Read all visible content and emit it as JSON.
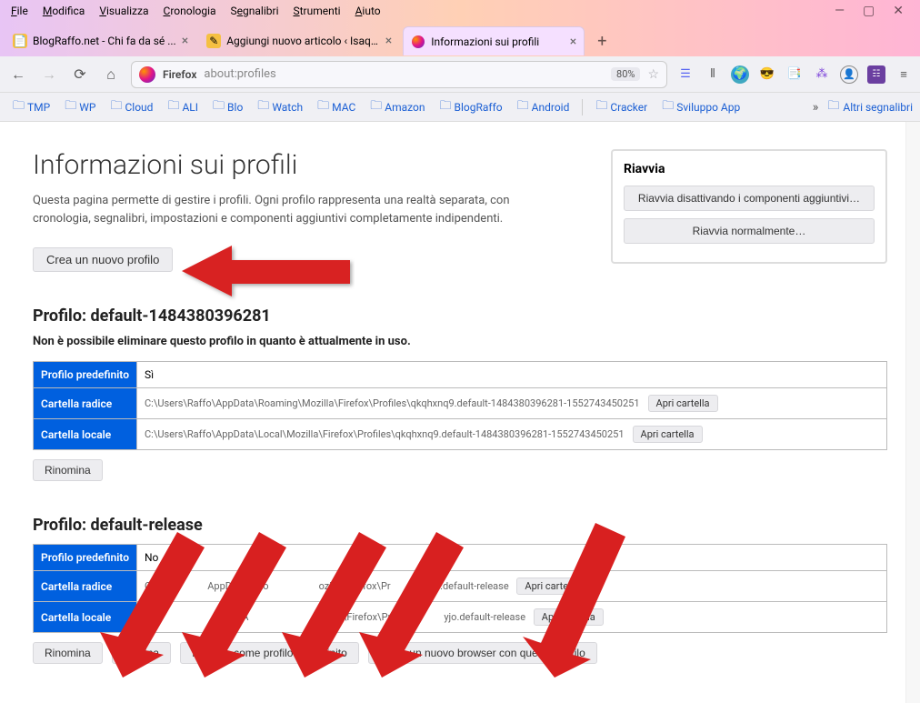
{
  "menubar": {
    "items": [
      "File",
      "Modifica",
      "Visualizza",
      "Cronologia",
      "Segnalibri",
      "Strumenti",
      "Aiuto"
    ]
  },
  "tabs": {
    "items": [
      {
        "title": "BlogRaffo.net - Chi fa da sé ..."
      },
      {
        "title": "Aggiungi nuovo articolo ‹ Isaqu..."
      },
      {
        "title": "Informazioni sui profili"
      }
    ]
  },
  "toolbar": {
    "identity": "Firefox",
    "url": "about:profiles",
    "zoom": "80%"
  },
  "bookmarks": {
    "items": [
      "TMP",
      "WP",
      "Cloud",
      "ALI",
      "Blo",
      "Watch",
      "MAC",
      "Amazon",
      "BlogRaffo",
      "Android",
      "Cracker",
      "Sviluppo App"
    ],
    "other": "Altri segnalibri",
    "more_icon": "»"
  },
  "page": {
    "title": "Informazioni sui profili",
    "description": "Questa pagina permette di gestire i profili. Ogni profilo rappresenta una realtà separata, con cronologia, segnalibri, impostazioni e componenti aggiuntivi completamente indipendenti.",
    "create_profile": "Crea un nuovo profilo",
    "restart": {
      "title": "Riavvia",
      "safe_mode": "Riavvia disattivando i componenti aggiuntivi…",
      "normal": "Riavvia normalmente…"
    },
    "labels": {
      "default_profile": "Profilo predefinito",
      "root_dir": "Cartella radice",
      "local_dir": "Cartella locale",
      "open_folder": "Apri cartella"
    },
    "buttons": {
      "rename": "Rinomina",
      "delete": "Elimina",
      "set_default": "Imposta come profilo predefinito",
      "launch": "Avvia un nuovo browser con questo profilo"
    },
    "profiles": [
      {
        "heading": "Profilo: default-1484380396281",
        "warning": "Non è possibile eliminare questo profilo in quanto è attualmente in uso.",
        "is_default": "Sì",
        "root": "C:\\Users\\Raffo\\AppData\\Roaming\\Mozilla\\Firefox\\Profiles\\qkqhxnq9.default-1484380396281-1552743450251",
        "local": "C:\\Users\\Raffo\\AppData\\Local\\Mozilla\\Firefox\\Profiles\\qkqhxnq9.default-1484380396281-1552743450251"
      },
      {
        "heading": "Profilo: default-release",
        "is_default": "No",
        "root_partial_a": "C",
        "root_partial_b": "AppD",
        "root_partial_c": "Ro",
        "root_partial_d": "ozilla\\Firefox\\Pr",
        "root_partial_e": "o.default-release",
        "local_partial_a": "o\\A",
        "local_partial_b": "\\Firefox\\Prof",
        "local_partial_c": "yjo.default-release"
      }
    ]
  }
}
